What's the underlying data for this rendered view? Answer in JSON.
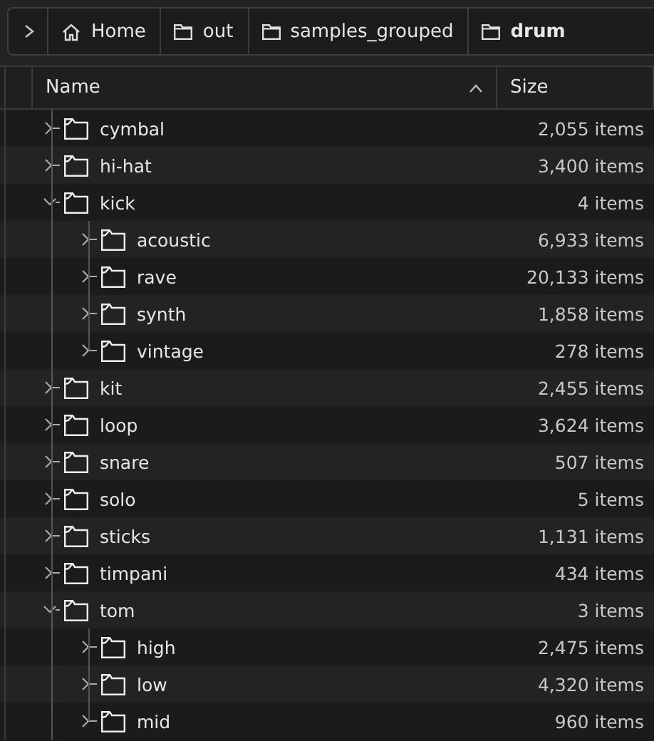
{
  "breadcrumb": [
    {
      "label": "Home",
      "kind": "home",
      "selected": false
    },
    {
      "label": "out",
      "kind": "folder",
      "selected": false
    },
    {
      "label": "samples_grouped",
      "kind": "folder",
      "selected": false
    },
    {
      "label": "drum",
      "kind": "folder",
      "selected": true
    }
  ],
  "columns": [
    {
      "label": "Name",
      "sorted": true
    },
    {
      "label": "Size",
      "sorted": false
    }
  ],
  "rows": [
    {
      "name": "cymbal",
      "size": "2,055 items",
      "expanded": false
    },
    {
      "name": "hi-hat",
      "size": "3,400 items",
      "expanded": false
    },
    {
      "name": "kick",
      "size": "4 items",
      "expanded": true,
      "children": [
        {
          "name": "acoustic",
          "size": "6,933 items",
          "expanded": false
        },
        {
          "name": "rave",
          "size": "20,133 items",
          "expanded": false
        },
        {
          "name": "synth",
          "size": "1,858 items",
          "expanded": false
        },
        {
          "name": "vintage",
          "size": "278 items",
          "expanded": false
        }
      ]
    },
    {
      "name": "kit",
      "size": "2,455 items",
      "expanded": false
    },
    {
      "name": "loop",
      "size": "3,624 items",
      "expanded": false
    },
    {
      "name": "snare",
      "size": "507 items",
      "expanded": false
    },
    {
      "name": "solo",
      "size": "5 items",
      "expanded": false
    },
    {
      "name": "sticks",
      "size": "1,131 items",
      "expanded": false
    },
    {
      "name": "timpani",
      "size": "434 items",
      "expanded": false
    },
    {
      "name": "tom",
      "size": "3 items",
      "expanded": true,
      "children": [
        {
          "name": "high",
          "size": "2,475 items",
          "expanded": false
        },
        {
          "name": "low",
          "size": "4,320 items",
          "expanded": false
        },
        {
          "name": "mid",
          "size": "960 items",
          "expanded": false
        }
      ]
    }
  ]
}
